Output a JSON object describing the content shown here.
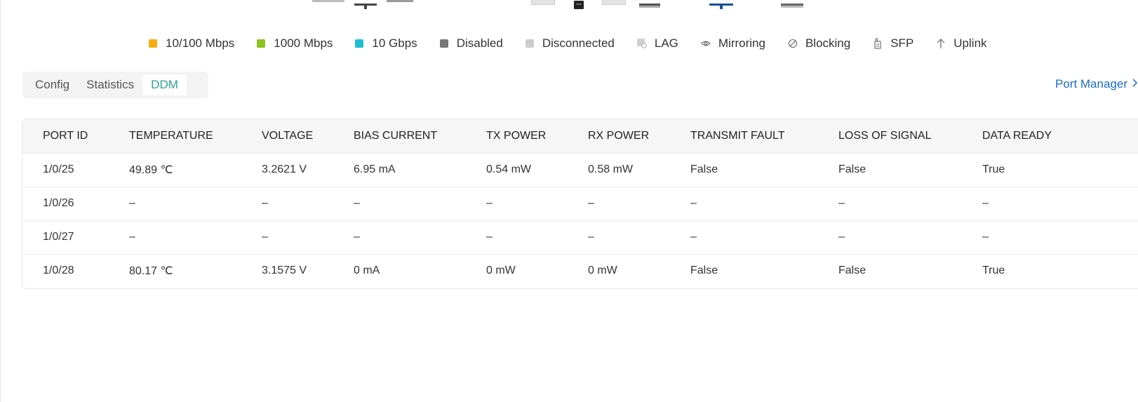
{
  "legend": [
    {
      "kind": "swatch",
      "color": "#f5ad12",
      "label": "10/100 Mbps"
    },
    {
      "kind": "swatch",
      "color": "#8dc21f",
      "label": "1000 Mbps"
    },
    {
      "kind": "swatch",
      "color": "#1ebed6",
      "label": "10 Gbps"
    },
    {
      "kind": "swatch",
      "color": "#777777",
      "label": "Disabled"
    },
    {
      "kind": "swatch",
      "color": "#cccccc",
      "label": "Disconnected"
    },
    {
      "kind": "icon",
      "icon": "lag-icon",
      "label": "LAG"
    },
    {
      "kind": "icon",
      "icon": "eye-icon",
      "label": "Mirroring"
    },
    {
      "kind": "icon",
      "icon": "blocking-icon",
      "label": "Blocking"
    },
    {
      "kind": "icon",
      "icon": "sfp-icon",
      "label": "SFP"
    },
    {
      "kind": "icon",
      "icon": "arrow-up-icon",
      "label": "Uplink"
    }
  ],
  "tabs": [
    {
      "label": "Config",
      "active": false
    },
    {
      "label": "Statistics",
      "active": false
    },
    {
      "label": "DDM",
      "active": true
    }
  ],
  "port_manager": {
    "label": "Port Manager",
    "icon": "chevron-right-icon"
  },
  "table": {
    "columns": [
      "PORT ID",
      "TEMPERATURE",
      "VOLTAGE",
      "BIAS CURRENT",
      "TX POWER",
      "RX POWER",
      "TRANSMIT FAULT",
      "LOSS OF SIGNAL",
      "DATA READY"
    ],
    "rows": [
      [
        "1/0/25",
        "49.89 ℃",
        "3.2621 V",
        "6.95 mA",
        "0.54 mW",
        "0.58 mW",
        "False",
        "False",
        "True"
      ],
      [
        "1/0/26",
        "–",
        "–",
        "–",
        "–",
        "–",
        "–",
        "–",
        "–"
      ],
      [
        "1/0/27",
        "–",
        "–",
        "–",
        "–",
        "–",
        "–",
        "–",
        "–"
      ],
      [
        "1/0/28",
        "80.17 ℃",
        "3.1575 V",
        "0 mA",
        "0 mW",
        "0 mW",
        "False",
        "False",
        "True"
      ]
    ]
  },
  "colors": {
    "accent": "#2aa58f",
    "link": "#1a6dc2"
  }
}
